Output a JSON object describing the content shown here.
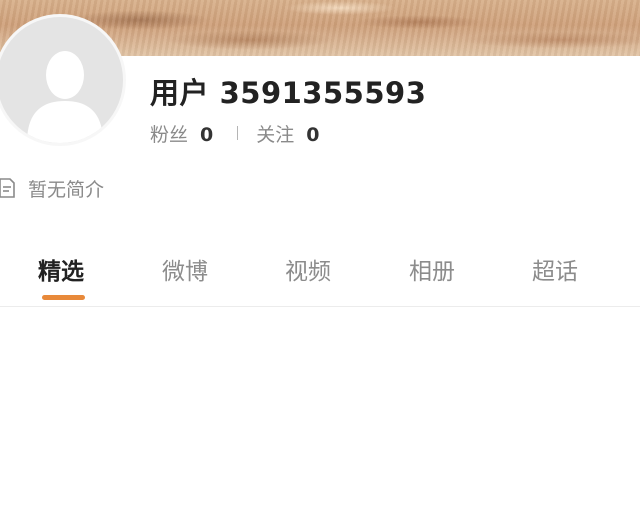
{
  "profile": {
    "username": "用户 3591355593",
    "fans_label": "粉丝",
    "fans_count": "0",
    "following_label": "关注",
    "following_count": "0",
    "bio": "暂无简介"
  },
  "tabs": [
    {
      "label": "精选",
      "active": true
    },
    {
      "label": "微博",
      "active": false
    },
    {
      "label": "视频",
      "active": false
    },
    {
      "label": "相册",
      "active": false
    },
    {
      "label": "超话",
      "active": false
    }
  ],
  "icons": {
    "avatar": "default-avatar-icon",
    "bio": "document-icon"
  },
  "colors": {
    "tab_indicator": "#e8893a",
    "active_text": "#222222",
    "inactive_text": "#8c8c8c"
  }
}
